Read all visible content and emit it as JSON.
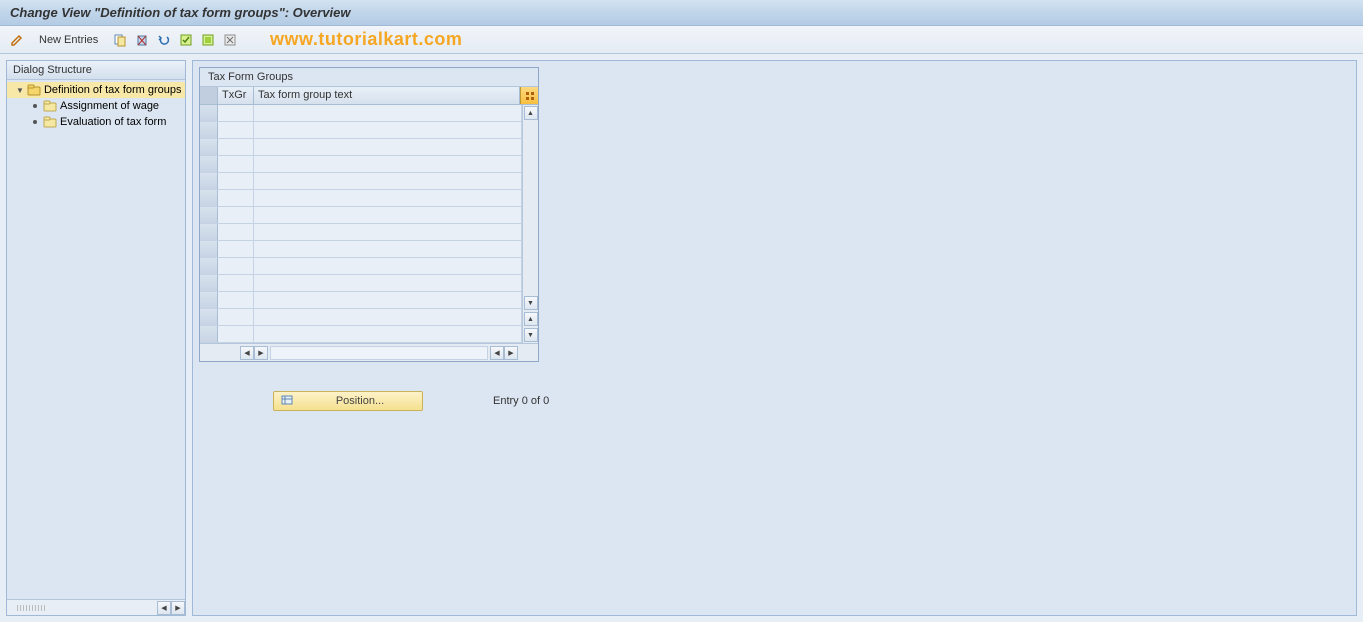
{
  "title": "Change View \"Definition of tax form groups\": Overview",
  "toolbar": {
    "new_entries": "New Entries"
  },
  "watermark": "www.tutorialkart.com",
  "sidebar": {
    "header": "Dialog Structure",
    "items": [
      {
        "label": "Definition of tax form groups",
        "selected": true,
        "level": 1,
        "open": true
      },
      {
        "label": "Assignment of wage",
        "selected": false,
        "level": 2,
        "open": false
      },
      {
        "label": "Evaluation of tax form",
        "selected": false,
        "level": 2,
        "open": false
      }
    ]
  },
  "table": {
    "title": "Tax Form Groups",
    "columns": {
      "c1": "TxGr",
      "c2": "Tax form group text"
    },
    "row_count": 14
  },
  "footer": {
    "position_label": "Position...",
    "entry_text": "Entry 0 of 0"
  }
}
